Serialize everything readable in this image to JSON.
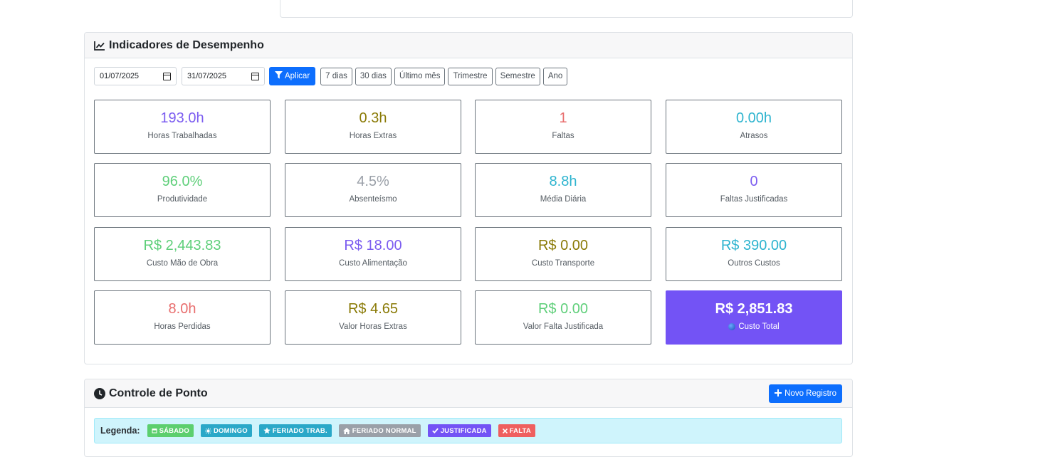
{
  "performance": {
    "title": "Indicadores de Desempenho",
    "date_start": "01/07/2025",
    "date_end": "31/07/2025",
    "apply_label": "Aplicar",
    "ranges": [
      "7 dias",
      "30 dias",
      "Último mês",
      "Trimestre",
      "Semestre",
      "Ano"
    ],
    "kpis": [
      {
        "value": "193.0h",
        "label": "Horas Trabalhadas",
        "color": "#7b5cf0"
      },
      {
        "value": "0.3h",
        "label": "Horas Extras",
        "color": "#8a7a06"
      },
      {
        "value": "1",
        "label": "Faltas",
        "color": "#e86d6d"
      },
      {
        "value": "0.00h",
        "label": "Atrasos",
        "color": "#2eb4cf"
      },
      {
        "value": "96.0%",
        "label": "Produtividade",
        "color": "#5fcf7a"
      },
      {
        "value": "4.5%",
        "label": "Absenteísmo",
        "color": "#9aa0a8"
      },
      {
        "value": "8.8h",
        "label": "Média Diária",
        "color": "#2eb4cf"
      },
      {
        "value": "0",
        "label": "Faltas Justificadas",
        "color": "#7b5cf0"
      },
      {
        "value": "R$ 2,443.83",
        "label": "Custo Mão de Obra",
        "color": "#5fcf7a"
      },
      {
        "value": "R$ 18.00",
        "label": "Custo Alimentação",
        "color": "#7b5cf0"
      },
      {
        "value": "R$ 0.00",
        "label": "Custo Transporte",
        "color": "#8a7a06"
      },
      {
        "value": "R$ 390.00",
        "label": "Outros Custos",
        "color": "#2eb4cf"
      },
      {
        "value": "8.0h",
        "label": "Horas Perdidas",
        "color": "#e86d6d"
      },
      {
        "value": "R$ 4.65",
        "label": "Valor Horas Extras",
        "color": "#8a7a06"
      },
      {
        "value": "R$ 0.00",
        "label": "Valor Falta Justificada",
        "color": "#5fcf7a"
      },
      {
        "value": "R$ 2,851.83",
        "label": "Custo Total",
        "color": "#ffffff"
      }
    ]
  },
  "ponto": {
    "title": "Controle de Ponto",
    "new_label": "Novo Registro",
    "legend_label": "Legenda:",
    "badges": [
      {
        "label": "SÁBADO",
        "color": "#5ccf6e",
        "icon": "calendar-icon"
      },
      {
        "label": "DOMINGO",
        "color": "#2aa8c8",
        "icon": "sun-icon"
      },
      {
        "label": "FERIADO TRAB.",
        "color": "#2aa8c8",
        "icon": "star-icon"
      },
      {
        "label": "FERIADO NORMAL",
        "color": "#9aa0a8",
        "icon": "home-icon"
      },
      {
        "label": "JUSTIFICADA",
        "color": "#7353f5",
        "icon": "check-icon"
      },
      {
        "label": "FALTA",
        "color": "#ef5f5f",
        "icon": "x-icon"
      }
    ]
  }
}
